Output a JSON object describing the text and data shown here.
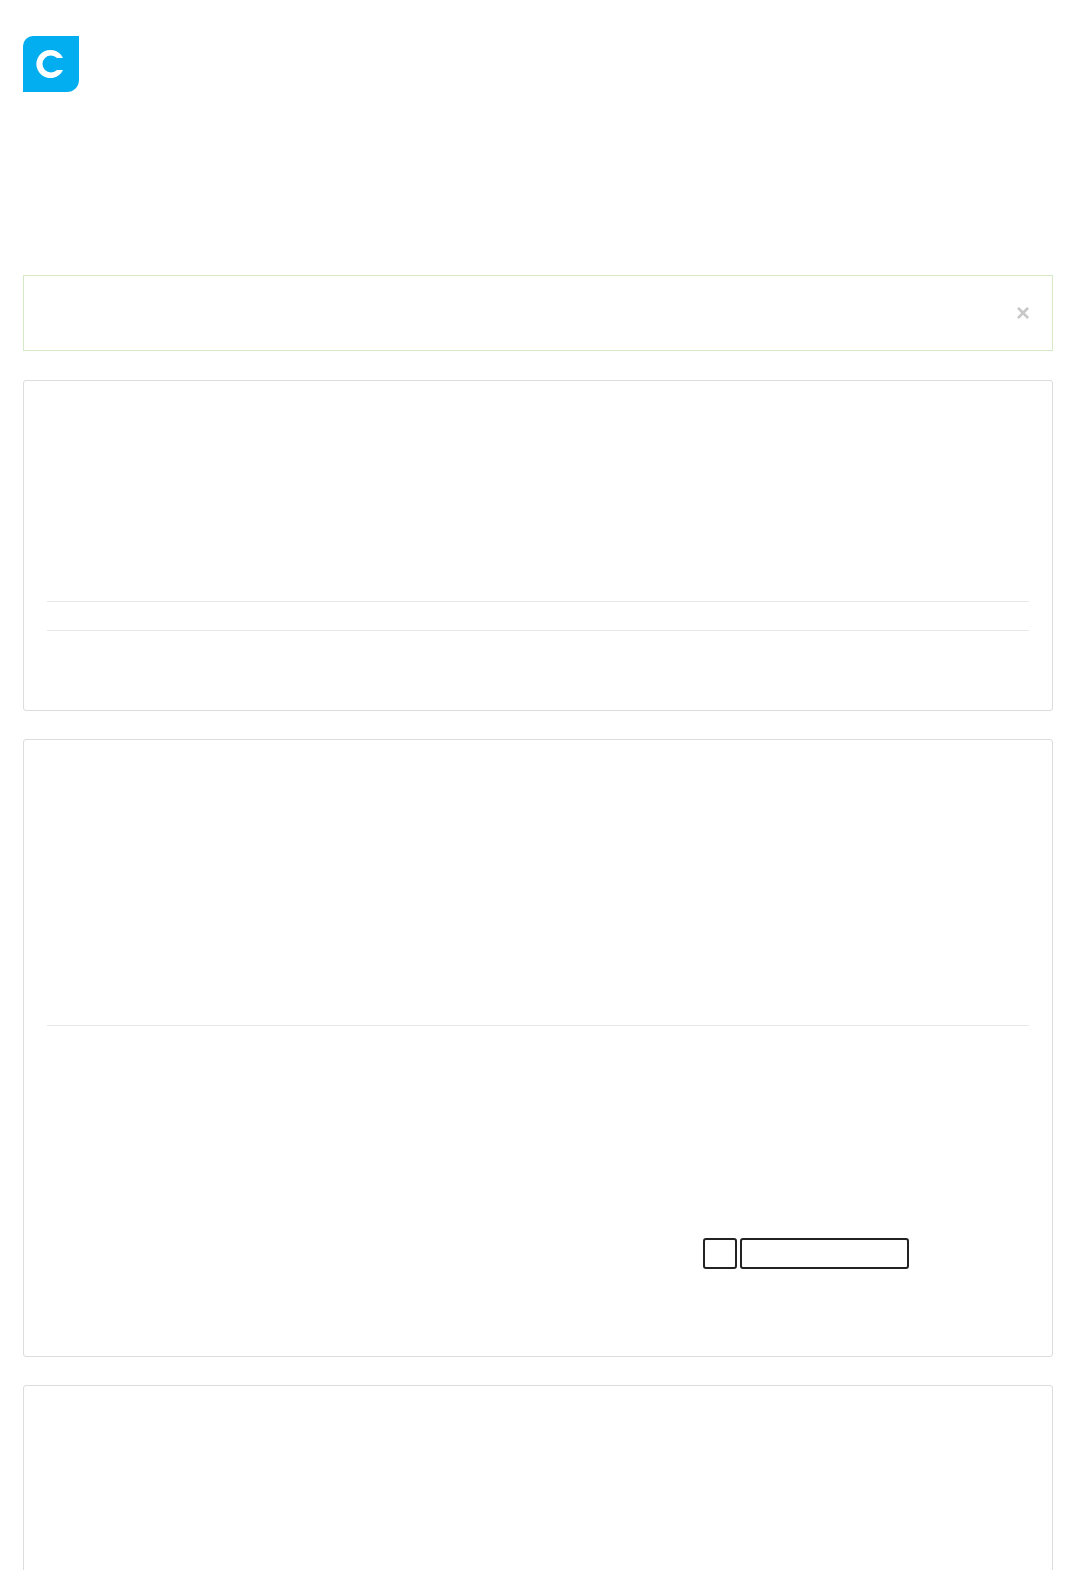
{
  "alert": {
    "dismissible": true,
    "close": "×"
  },
  "panels": [
    {
      "kind": "two-rules"
    },
    {
      "kind": "form"
    },
    {
      "kind": "plain"
    }
  ],
  "form": {
    "fields": [
      {
        "kind": "checkbox",
        "checked": false
      },
      {
        "kind": "text"
      }
    ]
  }
}
